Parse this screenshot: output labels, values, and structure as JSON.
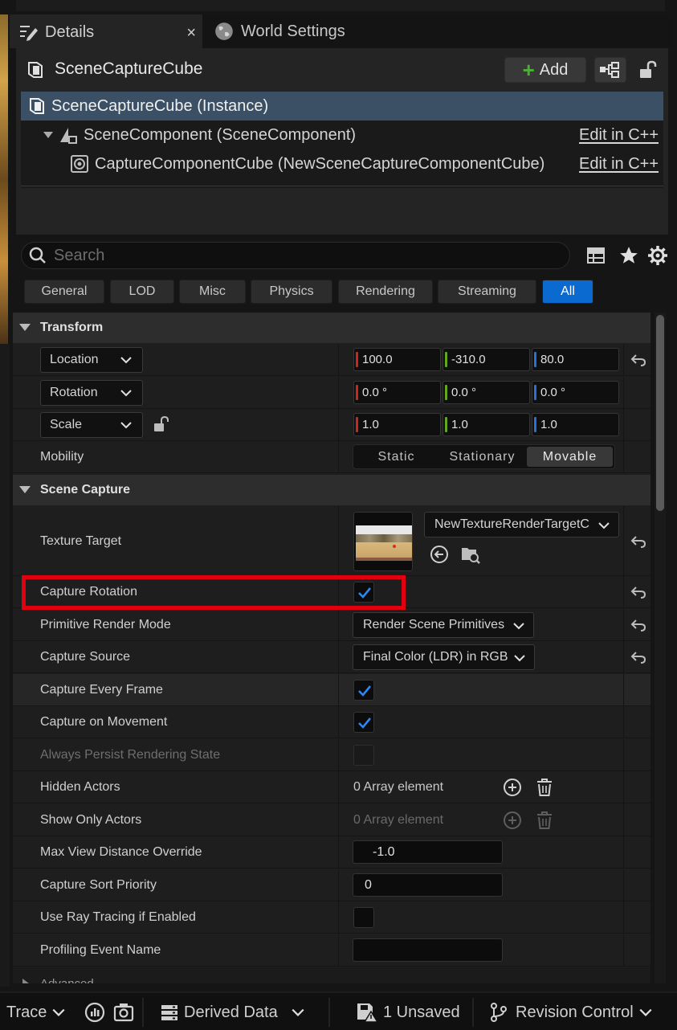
{
  "tabs": [
    {
      "label": "Details",
      "active": true
    },
    {
      "label": "World Settings",
      "active": false
    }
  ],
  "tab_close_glyph": "×",
  "actor": {
    "name": "SceneCaptureCube",
    "add_label": "Add"
  },
  "components": [
    {
      "label": "SceneCaptureCube (Instance)",
      "selected": true
    },
    {
      "label": "SceneComponent (SceneComponent)",
      "link": "Edit in C++"
    },
    {
      "label": "CaptureComponentCube (NewSceneCaptureComponentCube)",
      "link": "Edit in C++"
    }
  ],
  "search": {
    "placeholder": "Search",
    "value": ""
  },
  "filters": [
    "General",
    "LOD",
    "Misc",
    "Physics",
    "Rendering",
    "Streaming",
    "All"
  ],
  "active_filter": "All",
  "transform": {
    "category": "Transform",
    "location": {
      "label": "Location",
      "x": "100.0",
      "y": "-310.0",
      "z": "80.0"
    },
    "rotation": {
      "label": "Rotation",
      "x": "0.0 °",
      "y": "0.0 °",
      "z": "0.0 °"
    },
    "scale": {
      "label": "Scale",
      "x": "1.0",
      "y": "1.0",
      "z": "1.0"
    },
    "mobility": {
      "label": "Mobility",
      "options": [
        "Static",
        "Stationary",
        "Movable"
      ],
      "selected": "Movable"
    }
  },
  "scene_capture": {
    "category": "Scene Capture",
    "texture_target": {
      "label": "Texture Target",
      "value": "NewTextureRenderTargetC"
    },
    "capture_rotation": {
      "label": "Capture Rotation",
      "checked": true
    },
    "primitive_render_mode": {
      "label": "Primitive Render Mode",
      "value": "Render Scene Primitives"
    },
    "capture_source": {
      "label": "Capture Source",
      "value": "Final Color (LDR) in RGB"
    },
    "capture_every_frame": {
      "label": "Capture Every Frame",
      "checked": true
    },
    "capture_on_movement": {
      "label": "Capture on Movement",
      "checked": true
    },
    "always_persist": {
      "label": "Always Persist Rendering State",
      "checked": false
    },
    "hidden_actors": {
      "label": "Hidden Actors",
      "value": "0 Array element"
    },
    "show_only_actors": {
      "label": "Show Only Actors",
      "value": "0 Array element"
    },
    "max_view_distance": {
      "label": "Max View Distance Override",
      "value": "-1.0"
    },
    "capture_sort_priority": {
      "label": "Capture Sort Priority",
      "value": "0"
    },
    "use_ray_tracing": {
      "label": "Use Ray Tracing if Enabled",
      "checked": false
    },
    "profiling_event_name": {
      "label": "Profiling Event Name",
      "value": ""
    },
    "advanced": "Advanced"
  },
  "statusbar": {
    "trace": "Trace",
    "derived_data": "Derived Data",
    "unsaved": "1 Unsaved",
    "revision_control": "Revision Control"
  },
  "colors": {
    "accent": "#0a6ad0",
    "axis_x": "#c8291c",
    "axis_y": "#63a51f",
    "axis_z": "#2a6fd6",
    "add_plus": "#4caf3a",
    "annotation": "#e0000f"
  }
}
